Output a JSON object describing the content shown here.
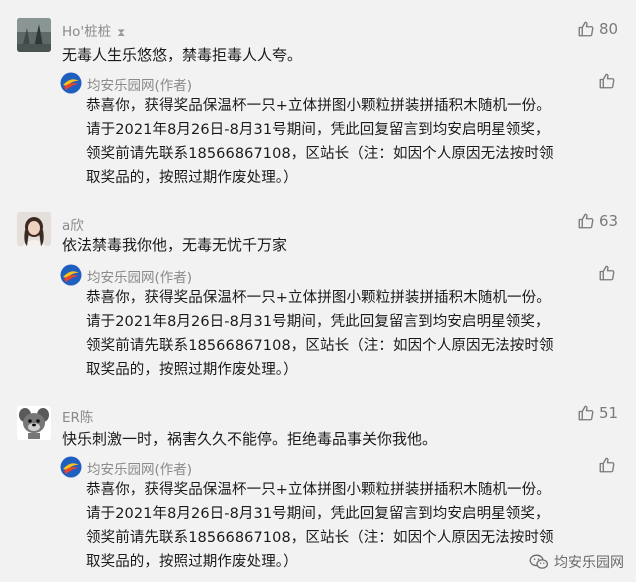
{
  "comments": [
    {
      "name": "Ho'桩桩",
      "likes": "80",
      "text": "无毒人生乐悠悠，禁毒拒毒人人夸。",
      "reply": {
        "author": "均安乐园网(作者)",
        "lines": [
          "恭喜你，获得奖品保温杯一只+立体拼图小颗粒拼装拼插积木随机一份。",
          "请于2021年8月26日-8月31号期间，凭此回复留言到均安启明星领奖，",
          "领奖前请先联系18566867108，区站长（注：如因个人原因无法按时领",
          "取奖品的，按照过期作废处理。）"
        ]
      }
    },
    {
      "name": "a欣",
      "likes": "63",
      "text": "依法禁毒我你他，无毒无忧千万家",
      "reply": {
        "author": "均安乐园网(作者)",
        "lines": [
          "恭喜你，获得奖品保温杯一只+立体拼图小颗粒拼装拼插积木随机一份。",
          "请于2021年8月26日-8月31号期间，凭此回复留言到均安启明星领奖，",
          "领奖前请先联系18566867108，区站长（注：如因个人原因无法按时领",
          "取奖品的，按照过期作废处理。）"
        ]
      }
    },
    {
      "name": "ER陈",
      "likes": "51",
      "text": "快乐刺激一时，祸害久久不能停。拒绝毒品事关你我他。",
      "reply": {
        "author": "均安乐园网(作者)",
        "lines": [
          "恭喜你，获得奖品保温杯一只+立体拼图小颗粒拼装拼插积木随机一份。",
          "请于2021年8月26日-8月31号期间，凭此回复留言到均安启明星领奖，",
          "领奖前请先联系18566867108，区站长（注：如因个人原因无法按时领",
          "取奖品的，按照过期作废处理。）"
        ]
      }
    }
  ],
  "watermark": "均安乐园网",
  "icons": {
    "like": "thumbs-up-icon",
    "watermark": "wechat-icon",
    "verified": "hourglass-badge-icon"
  },
  "colors": {
    "background": "#f2f2f2",
    "meta_text": "#8a8a8a",
    "body_text": "#1a1a1a"
  }
}
